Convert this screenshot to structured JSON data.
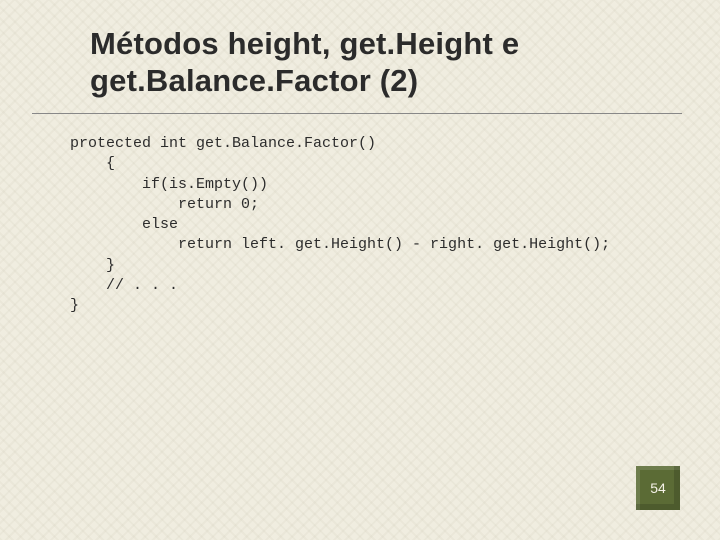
{
  "title_line1": "Métodos height, get.Height e",
  "title_line2": "get.Balance.Factor (2)",
  "code": "protected int get.Balance.Factor()\n    {\n        if(is.Empty())\n            return 0;\n        else\n            return left. get.Height() - right. get.Height();\n    }\n    // . . .\n}",
  "page_number": "54"
}
